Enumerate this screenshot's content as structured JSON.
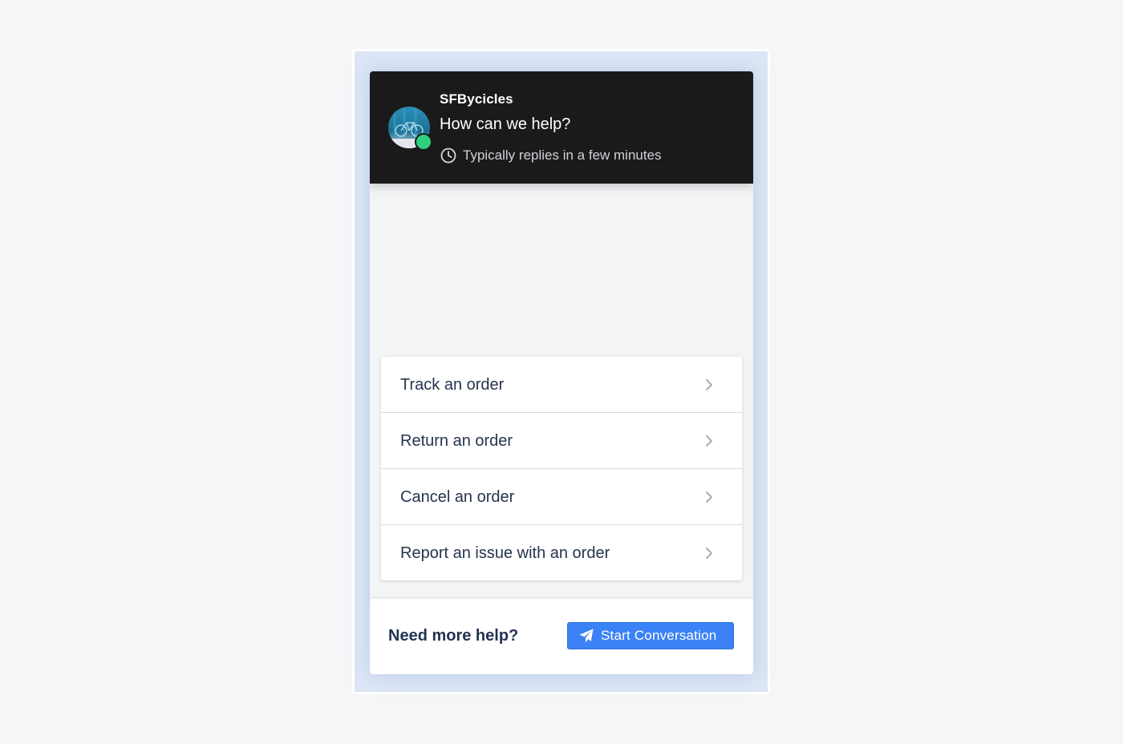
{
  "header": {
    "brand": "SFBycicles",
    "headline": "How can we help?",
    "reply_time": "Typically replies in a few minutes",
    "status": "online",
    "status_color": "#2ecf7f",
    "background_color": "#1a1a1a"
  },
  "options": [
    {
      "label": "Track an order",
      "icon": "chevron-right-icon"
    },
    {
      "label": "Return an order",
      "icon": "chevron-right-icon"
    },
    {
      "label": "Cancel an order",
      "icon": "chevron-right-icon"
    },
    {
      "label": "Report an issue with an order",
      "icon": "chevron-right-icon"
    }
  ],
  "footer": {
    "prompt": "Need more help?",
    "button_label": "Start Conversation",
    "button_icon": "paper-plane-icon",
    "button_color": "#3b82f6"
  }
}
